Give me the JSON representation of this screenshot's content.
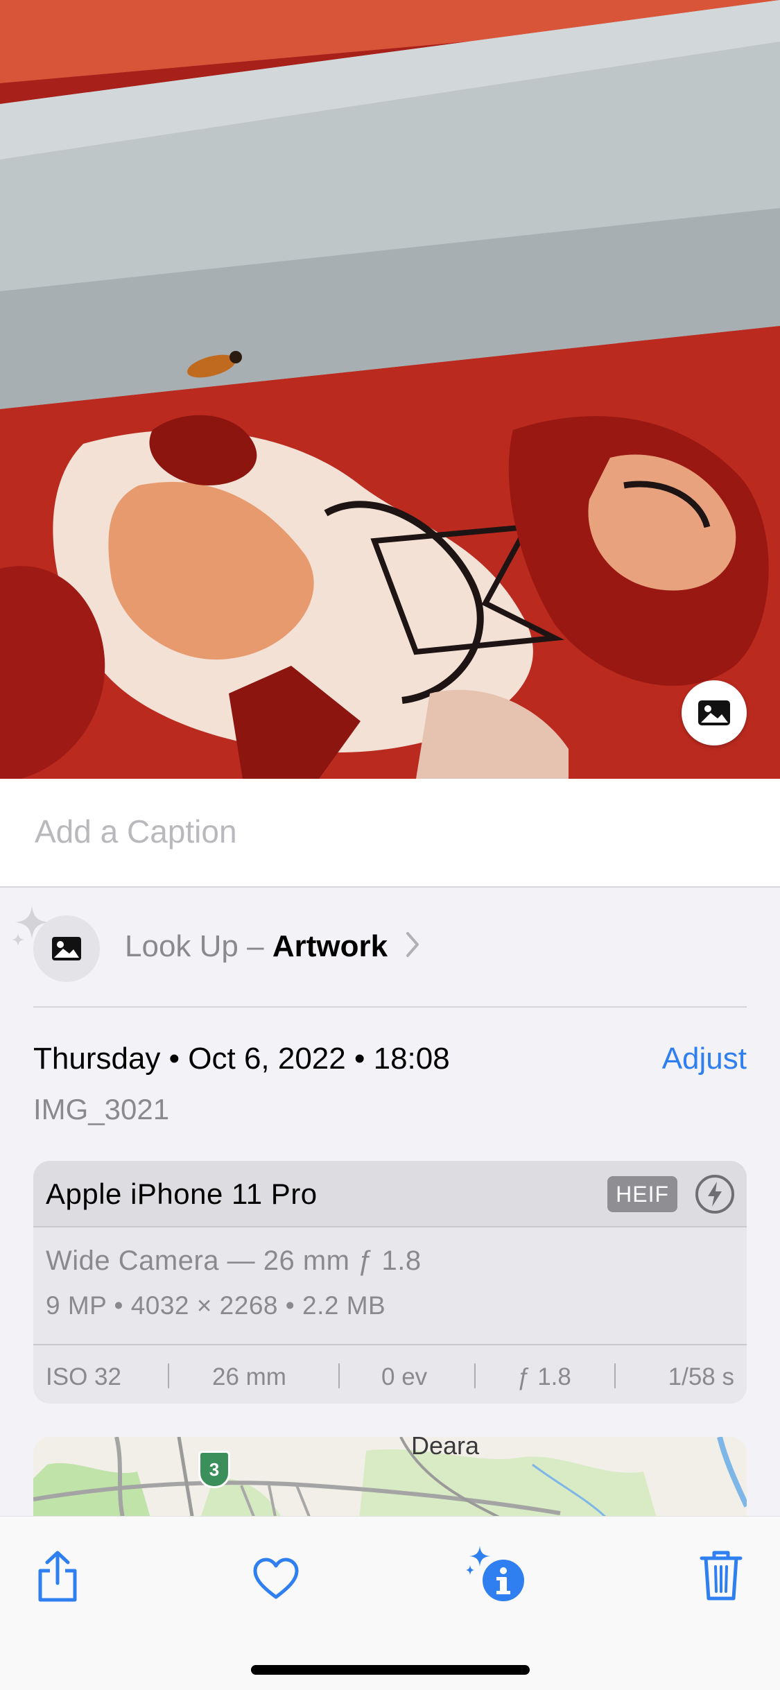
{
  "caption": {
    "placeholder": "Add a Caption",
    "value": ""
  },
  "lookup": {
    "prefix": "Look Up – ",
    "subject": "Artwork"
  },
  "info": {
    "date": "Thursday • Oct 6, 2022 • 18:08",
    "adjust_label": "Adjust",
    "filename": "IMG_3021"
  },
  "camera": {
    "device": "Apple iPhone 11 Pro",
    "format": "HEIF",
    "lens": "Wide Camera — 26 mm ƒ 1.8",
    "specs": "9 MP  •  4032 × 2268  •  2.2 MB",
    "exif": {
      "iso": "ISO 32",
      "focal": "26 mm",
      "ev": "0 ev",
      "aperture": "ƒ 1.8",
      "shutter": "1/58 s"
    }
  },
  "map": {
    "place": "Deara",
    "route": "3"
  },
  "icons": {
    "visual_lookup": "photo-icon",
    "share": "share-icon",
    "favorite": "heart-icon",
    "info": "info-sparkle-icon",
    "delete": "trash-icon"
  },
  "colors": {
    "accent": "#2f7ff0",
    "background": "#f2f2f7"
  }
}
